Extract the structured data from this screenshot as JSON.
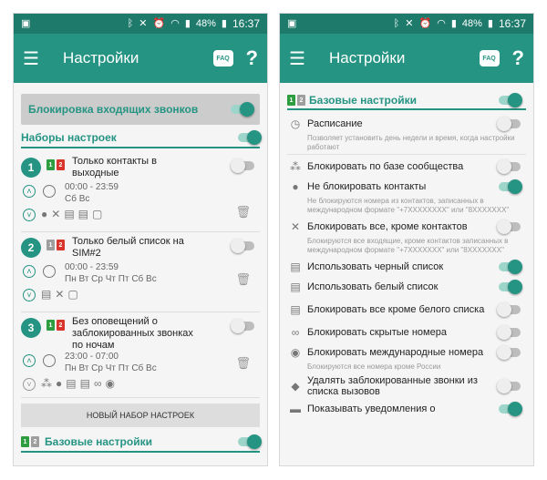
{
  "status": {
    "time": "16:37",
    "battery": "48%"
  },
  "left": {
    "title": "Настройки",
    "faq": "FAQ",
    "help": "?",
    "block_incoming": "Блокировка входящих звонков",
    "presets_header": "Наборы настроек",
    "presets": [
      {
        "num": "1",
        "name": "Только контакты в выходные",
        "time": "00:00 - 23:59",
        "days": "Сб Вс"
      },
      {
        "num": "2",
        "name": "Только белый список на SIM#2",
        "time": "00:00 - 23:59",
        "days": "Пн Вт Ср Чт Пт Сб Вс"
      },
      {
        "num": "3",
        "name": "Без оповещений о заблокированных звонках по ночам",
        "time": "23:00 - 07:00",
        "days": "Пн Вт Ср Чт Пт Сб Вс"
      }
    ],
    "new_preset": "НОВЫЙ НАБОР НАСТРОЕК",
    "base_header": "Базовые настройки"
  },
  "right": {
    "title": "Настройки",
    "faq": "FAQ",
    "help": "?",
    "base_header": "Базовые настройки",
    "schedule": "Расписание",
    "schedule_hint": "Позволяет установить день недели и время, когда настройки работают",
    "community": "Блокировать по базе сообщества",
    "no_block_contacts": "Не блокировать контакты",
    "no_block_hint": "Не блокируются номера из контактов, записанных в международном формате \"+7XXXXXXXX\" или \"8XXXXXXX\"",
    "block_all_except": "Блокировать все, кроме контактов",
    "block_all_hint": "Блокируются все входящие, кроме контактов записанных в международном формате \"+7XXXXXXX\" или \"8XXXXXXX\"",
    "use_black": "Использовать черный список",
    "use_white": "Использовать белый список",
    "block_except_white": "Блокировать все кроме белого списка",
    "block_hidden": "Блокировать скрытые номера",
    "block_intl": "Блокировать международные номера",
    "block_intl_hint": "Блокируются все номера кроме России",
    "delete_blocked": "Удалять заблокированные звонки из списка вызовов",
    "show_notifications": "Показывать уведомления о"
  }
}
